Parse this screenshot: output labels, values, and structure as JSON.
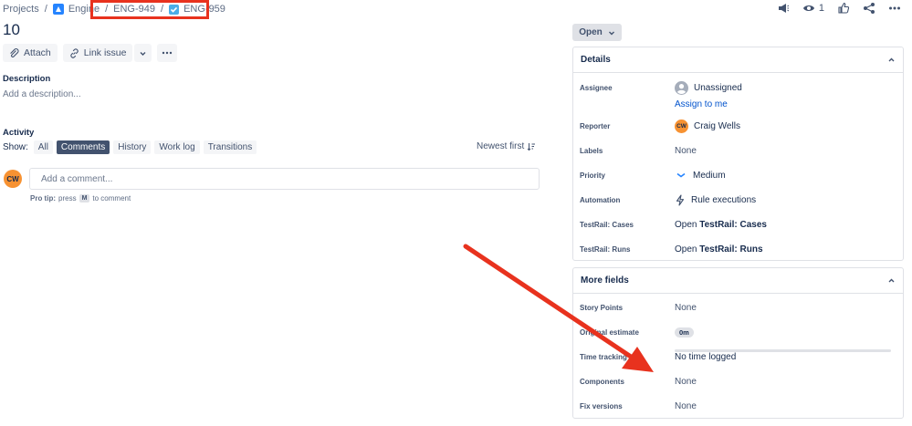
{
  "breadcrumb": {
    "projects": "Projects",
    "engine": "Engine",
    "parent": "ENG-949",
    "current": "ENG-959",
    "separator": "/"
  },
  "top_actions": {
    "watch_count": "1",
    "icons": [
      "megaphone-icon",
      "eye-icon",
      "thumbs-up-icon",
      "share-icon",
      "more-icon"
    ]
  },
  "issue": {
    "title": "10"
  },
  "toolbar": {
    "attach_label": "Attach",
    "link_issue_label": "Link issue"
  },
  "description": {
    "heading": "Description",
    "placeholder": "Add a description..."
  },
  "activity": {
    "heading": "Activity",
    "show_label": "Show:",
    "filters": [
      {
        "label": "All",
        "active": false
      },
      {
        "label": "Comments",
        "active": true
      },
      {
        "label": "History",
        "active": false
      },
      {
        "label": "Work log",
        "active": false
      },
      {
        "label": "Transitions",
        "active": false
      }
    ],
    "sort_label": "Newest first",
    "user_initials": "CW",
    "comment_placeholder": "Add a comment...",
    "pro_tip_bold": "Pro tip:",
    "pro_tip_press": "press",
    "pro_tip_key": "M",
    "pro_tip_rest": "to comment"
  },
  "status": {
    "label": "Open"
  },
  "details": {
    "heading": "Details",
    "assignee_label": "Assignee",
    "assignee_value": "Unassigned",
    "assign_to_me": "Assign to me",
    "reporter_label": "Reporter",
    "reporter_initials": "CW",
    "reporter_value": "Craig Wells",
    "labels_label": "Labels",
    "labels_value": "None",
    "priority_label": "Priority",
    "priority_value": "Medium",
    "automation_label": "Automation",
    "automation_value": "Rule executions",
    "testrail_cases_label": "TestRail: Cases",
    "testrail_cases_prefix": "Open",
    "testrail_cases_link": "TestRail: Cases",
    "testrail_runs_label": "TestRail: Runs",
    "testrail_runs_prefix": "Open",
    "testrail_runs_link": "TestRail: Runs"
  },
  "more_fields": {
    "heading": "More fields",
    "story_points_label": "Story Points",
    "story_points_value": "None",
    "original_estimate_label": "Original estimate",
    "original_estimate_value": "0m",
    "time_tracking_label": "Time tracking",
    "time_tracking_value": "No time logged",
    "components_label": "Components",
    "components_value": "None",
    "fix_versions_label": "Fix versions",
    "fix_versions_value": "None"
  },
  "colors": {
    "annotation_red": "#e8321e",
    "link_blue": "#0052cc",
    "avatar_orange": "#f79232"
  }
}
